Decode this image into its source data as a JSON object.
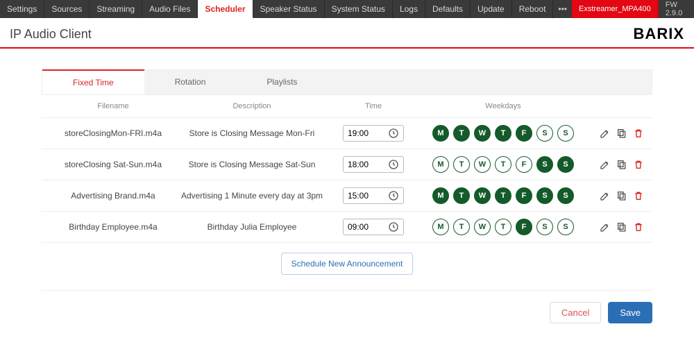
{
  "nav": {
    "tabs": [
      "Settings",
      "Sources",
      "Streaming",
      "Audio Files",
      "Scheduler",
      "Speaker Status",
      "System Status",
      "Logs",
      "Defaults",
      "Update",
      "Reboot"
    ],
    "active": "Scheduler",
    "more": "•••",
    "device": "Exstreamer_MPA400",
    "fw": "FW 2.9.0"
  },
  "header": {
    "title": "IP Audio Client",
    "brand": "BARIX"
  },
  "subtabs": {
    "items": [
      "Fixed Time",
      "Rotation",
      "Playlists"
    ],
    "active": "Fixed Time"
  },
  "columns": {
    "filename": "Filename",
    "description": "Description",
    "time": "Time",
    "weekdays": "Weekdays"
  },
  "dayLabels": [
    "M",
    "T",
    "W",
    "T",
    "F",
    "S",
    "S"
  ],
  "rows": [
    {
      "filename": "storeClosingMon-FRI.m4a",
      "description": "Store is Closing Message Mon-Fri",
      "time": "19:00",
      "days": [
        true,
        true,
        true,
        true,
        true,
        false,
        false
      ]
    },
    {
      "filename": "storeClosing Sat-Sun.m4a",
      "description": "Store is Closing Message Sat-Sun",
      "time": "18:00",
      "days": [
        false,
        false,
        false,
        false,
        false,
        true,
        true
      ]
    },
    {
      "filename": "Advertising Brand.m4a",
      "description": "Advertising 1 Minute every day at 3pm",
      "time": "15:00",
      "days": [
        true,
        true,
        true,
        true,
        true,
        true,
        true
      ]
    },
    {
      "filename": "Birthday Employee.m4a",
      "description": "Birthday Julia Employee",
      "time": "09:00",
      "days": [
        false,
        false,
        false,
        false,
        true,
        false,
        false
      ]
    }
  ],
  "buttons": {
    "new": "Schedule New Announcement",
    "cancel": "Cancel",
    "save": "Save"
  },
  "colors": {
    "accent": "#e30613",
    "dayOn": "#145a2a"
  }
}
